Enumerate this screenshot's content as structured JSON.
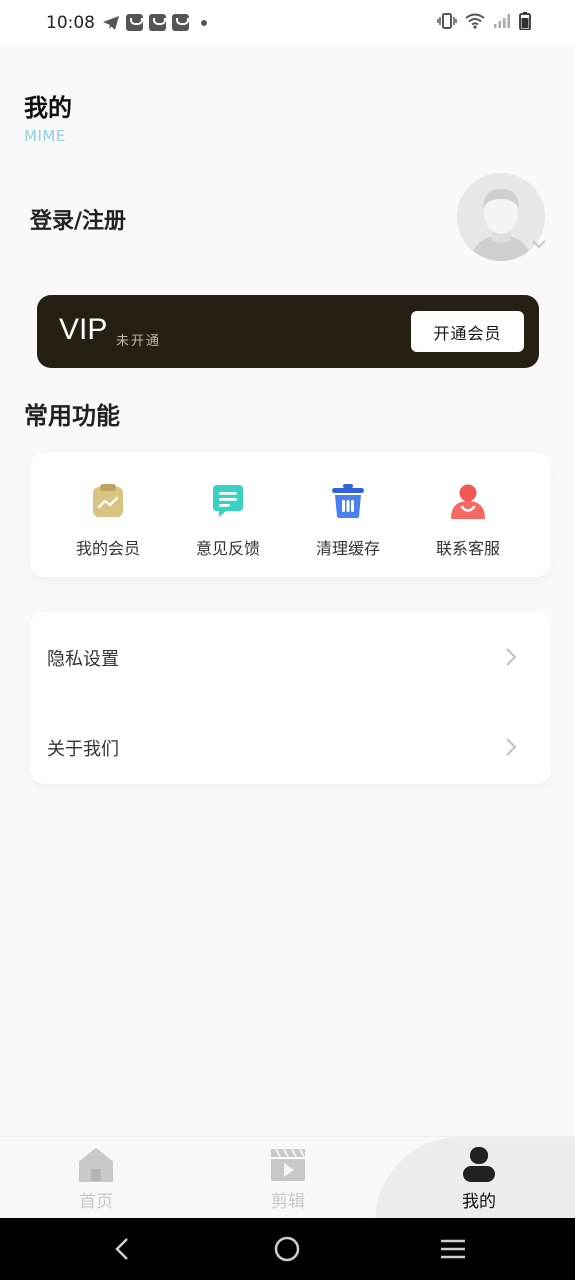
{
  "status_bar": {
    "time": "10:08",
    "left_icons": [
      "telegram-icon",
      "shopping-bag-icon",
      "shopping-bag-icon",
      "shopping-bag-icon",
      "dot-icon"
    ],
    "right_icons": [
      "vibrate-icon",
      "wifi-icon",
      "signal-icon",
      "battery-icon"
    ]
  },
  "header": {
    "title": "我的",
    "subtitle": "MIME"
  },
  "profile": {
    "login_text": "登录/注册",
    "avatar_icon": "default-avatar-icon"
  },
  "vip": {
    "label": "VIP",
    "status": "未开通",
    "button": "开通会员",
    "card_color": "#261f14"
  },
  "features": {
    "section_title": "常用功能",
    "items": [
      {
        "label": "我的会员",
        "icon": "membership-icon",
        "color": "#d4bf7a"
      },
      {
        "label": "意见反馈",
        "icon": "feedback-icon",
        "color": "#3fd4c6"
      },
      {
        "label": "清理缓存",
        "icon": "trash-icon",
        "color": "#4b7ff0"
      },
      {
        "label": "联系客服",
        "icon": "customer-service-icon",
        "color": "#f0605c"
      }
    ]
  },
  "menu": {
    "items": [
      {
        "label": "隐私设置"
      },
      {
        "label": "关于我们"
      }
    ]
  },
  "tabbar": {
    "items": [
      {
        "label": "首页",
        "icon": "home-icon",
        "active": false
      },
      {
        "label": "剪辑",
        "icon": "clapperboard-icon",
        "active": false
      },
      {
        "label": "我的",
        "icon": "person-icon",
        "active": true
      }
    ],
    "active_color": "#111111",
    "inactive_color": "#c8c8c8"
  },
  "system_nav": {
    "icons": [
      "back-icon",
      "home-circle-icon",
      "menu-icon"
    ]
  }
}
